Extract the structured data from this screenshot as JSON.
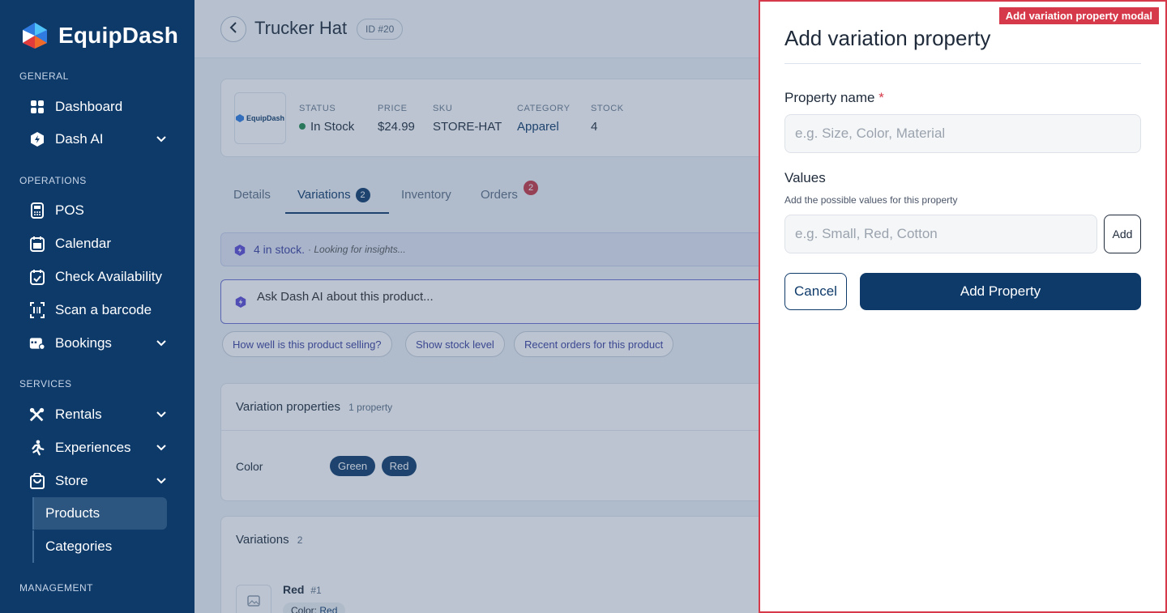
{
  "brand": {
    "name": "EquipDash"
  },
  "sidebar": {
    "sections": {
      "general": "GENERAL",
      "operations": "OPERATIONS",
      "services": "SERVICES",
      "management": "MANAGEMENT"
    },
    "items": {
      "dashboard": "Dashboard",
      "dash_ai": "Dash AI",
      "pos": "POS",
      "calendar": "Calendar",
      "check_availability": "Check Availability",
      "scan_barcode": "Scan a barcode",
      "bookings": "Bookings",
      "rentals": "Rentals",
      "experiences": "Experiences",
      "store": "Store",
      "products": "Products",
      "categories": "Categories"
    }
  },
  "product": {
    "title": "Trucker Hat",
    "id": "ID #20",
    "logo_text": "EquipDash",
    "status_label": "STATUS",
    "status_value": "In Stock",
    "price_label": "PRICE",
    "price_value": "$24.99",
    "sku_label": "SKU",
    "sku_value": "STORE-HAT",
    "category_label": "CATEGORY",
    "category_value": "Apparel",
    "stock_label": "STOCK",
    "stock_value": "4"
  },
  "tabs": {
    "details": "Details",
    "variations": "Variations",
    "variations_count": "2",
    "inventory": "Inventory",
    "orders": "Orders",
    "orders_count": "2"
  },
  "ai": {
    "insight_main": "4 in stock.",
    "insight_sub": "· Looking for insights...",
    "ask_placeholder": "Ask Dash AI about this product...",
    "chips": [
      "How well is this product selling?",
      "Show stock level",
      "Recent orders for this product"
    ]
  },
  "variation_properties": {
    "title": "Variation properties",
    "count": "1 property",
    "property_name": "Color",
    "values": [
      "Green",
      "Red"
    ]
  },
  "variations": {
    "title": "Variations",
    "count": "2",
    "first_name": "Red",
    "first_num": "#1",
    "first_attr_label": "Color:",
    "first_attr_value": "Red"
  },
  "modal": {
    "tag": "Add variation property modal",
    "title": "Add variation property",
    "property_name_label": "Property name",
    "required_mark": "*",
    "property_name_placeholder": "e.g. Size, Color, Material",
    "values_label": "Values",
    "values_hint": "Add the possible values for this property",
    "values_placeholder": "e.g. Small, Red, Cotton",
    "add_label": "Add",
    "cancel_label": "Cancel",
    "submit_label": "Add Property"
  },
  "colors": {
    "sidebar_bg": "#0e3a6a",
    "accent": "#0e3a6a",
    "danger": "#d63a4a",
    "status_ok": "#1f8a4c",
    "ai_purple": "#5b4bd6"
  }
}
